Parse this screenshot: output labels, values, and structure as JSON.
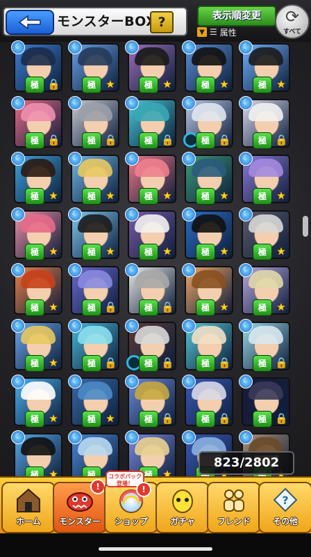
{
  "header": {
    "title": "モンスターBOX",
    "help_label": "?",
    "sort_button_label": "表示順変更",
    "filter_label": "属性",
    "refresh_label": "すべて"
  },
  "monster_box": {
    "count_text": "823/2802",
    "rows": [
      [
        {
          "c": "#3d7fd4",
          "h": "#1b2b4a",
          "s": "lock"
        },
        {
          "c": "#6aa1e8",
          "h": "#253a5a",
          "s": "star"
        },
        {
          "c": "#9b6fb8",
          "h": "#1a1a1a",
          "s": "star"
        },
        {
          "c": "#5b8fd6",
          "h": "#111",
          "s": "star"
        },
        {
          "c": "#6fb0ff",
          "h": "#1b1b1b",
          "s": "star"
        }
      ],
      [
        {
          "c": "#e86a8a",
          "h": "#f08fb0",
          "s": "lock"
        },
        {
          "c": "#c9c9d2",
          "h": "#9aa0a8",
          "s": "lock"
        },
        {
          "c": "#49c8d8",
          "h": "#38a7b6",
          "s": "lock"
        },
        {
          "c": "#b8c8e8",
          "h": "#dfe6f0",
          "s": "ring"
        },
        {
          "c": "#d9d9ef",
          "h": "#f2f2f2",
          "s": "lock"
        }
      ],
      [
        {
          "c": "#3ea4e0",
          "h": "#2b1a12",
          "s": "star"
        },
        {
          "c": "#6fb8e8",
          "h": "#e8c860",
          "s": "star"
        },
        {
          "c": "#f17a8a",
          "h": "#f0808f",
          "s": "star"
        },
        {
          "c": "#3d9a7a",
          "h": "#2a5b7c",
          "s": "star"
        },
        {
          "c": "#8b7bd8",
          "h": "#a38ae0",
          "s": "star"
        }
      ],
      [
        {
          "c": "#f08fa8",
          "h": "#e86a8a",
          "s": "star"
        },
        {
          "c": "#7fc8f0",
          "h": "#1b1b1b",
          "s": "star"
        },
        {
          "c": "#7a5ba8",
          "h": "#f2f2f2",
          "s": "star"
        },
        {
          "c": "#2b6fc8",
          "h": "#111",
          "s": "star"
        },
        {
          "c": "#5b5b6b",
          "h": "#d8d8d8",
          "s": "star"
        }
      ],
      [
        {
          "c": "#e8804a",
          "h": "#c8401a",
          "s": "star"
        },
        {
          "c": "#6a6ad0",
          "h": "#8a8ae0",
          "s": "lock"
        },
        {
          "c": "#e8e8e8",
          "h": "#a8a8a8",
          "s": "lock"
        },
        {
          "c": "#f0a868",
          "h": "#8a5020",
          "s": "star"
        },
        {
          "c": "#b8a8e0",
          "h": "#e0d8a8",
          "s": "star"
        }
      ],
      [
        {
          "c": "#6aa8f0",
          "h": "#e8c860",
          "s": "star"
        },
        {
          "c": "#4ab8d8",
          "h": "#8ae0f0",
          "s": "lock"
        },
        {
          "c": "#5a3a3a",
          "h": "#d8d8d8",
          "s": "ring"
        },
        {
          "c": "#58c8d8",
          "h": "#f0e0c8",
          "s": "lock"
        },
        {
          "c": "#9ad8e8",
          "h": "#d8e8f0",
          "s": "lock"
        }
      ],
      [
        {
          "c": "#4ab0f0",
          "h": "#ffffff",
          "s": "star"
        },
        {
          "c": "#3a6aa8",
          "h": "#4a8ac8",
          "s": "star"
        },
        {
          "c": "#6a8ad8",
          "h": "#c8a840",
          "s": "lock"
        },
        {
          "c": "#3a5ab8",
          "h": "#d8d8e8",
          "s": "lock"
        },
        {
          "c": "#1b1b3a",
          "h": "#3a3a5a",
          "s": "lock"
        }
      ],
      [
        {
          "c": "#58a8e8",
          "h": "#111",
          "s": "star"
        },
        {
          "c": "#4a88d8",
          "h": "#b8d8f0",
          "s": "star"
        },
        {
          "c": "#7a8ae0",
          "h": "#e8d090",
          "s": "star"
        },
        {
          "c": "#3a5ab8",
          "h": "#8ab0e0",
          "s": "star"
        },
        {
          "c": "#a8907a",
          "h": "#6a4a2a",
          "s": "star"
        }
      ]
    ]
  },
  "badges": {
    "kiwami": "極",
    "element": "☾"
  },
  "nav": {
    "items": [
      {
        "label": "ホーム",
        "icon": "home-icon"
      },
      {
        "label": "モンスター",
        "icon": "monster-icon"
      },
      {
        "label": "ショップ",
        "icon": "shop-icon"
      },
      {
        "label": "ガチャ",
        "icon": "gacha-icon"
      },
      {
        "label": "フレンド",
        "icon": "friend-icon"
      },
      {
        "label": "その他",
        "icon": "other-icon"
      }
    ],
    "collab_banner": "コラボパック\n登場！",
    "alert_mark": "!"
  },
  "colors": {
    "accent_blue": "#1b5fd6",
    "accent_green": "#2c8e1c",
    "nav_orange": "#e88e07",
    "star": "#ffd21e"
  }
}
